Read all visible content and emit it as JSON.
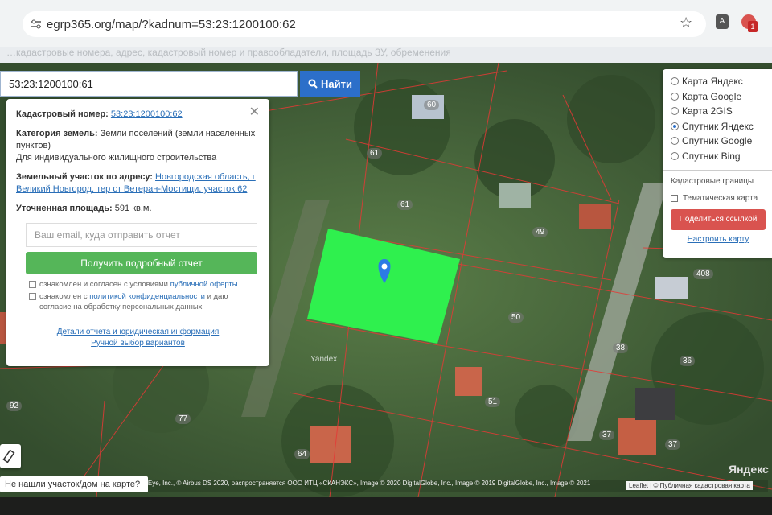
{
  "browser": {
    "url": "egrp365.org/map/?kadnum=53:23:1200100:62"
  },
  "page_strip_text": "…кадастровые номера, адрес, кадастровый номер и правообладатели, площадь ЗУ, обременения",
  "search": {
    "value": "53:23:1200100:61",
    "button_label": "Найти"
  },
  "info_panel": {
    "cadastral_label": "Кадастровый номер:",
    "cadastral_value": "53:23:1200100:62",
    "category_label": "Категория земель:",
    "category_value": "Земли поселений (земли населенных пунктов)",
    "use_value": "Для индивидуального жилищного строительства",
    "address_label": "Земельный участок по адресу:",
    "address_value": "Новгородская область, г Великий Новгород, тер ст Ветеран-Мостищи, участок 62",
    "area_label": "Уточненная площадь:",
    "area_value": "591 кв.м.",
    "email_placeholder": "Ваш email, куда отправить отчет",
    "report_button": "Получить подробный отчет",
    "consent1_text": "ознакомлен и согласен с условиями",
    "consent1_link": "публичной оферты",
    "consent2_text": "ознакомлен с",
    "consent2_link": "политикой конфиденциальности",
    "consent2_rest": "и даю согласие на обработку персональных данных",
    "link_details": "Детали отчета и юридическая информация",
    "link_manual": "Ручной выбор вариантов"
  },
  "layers": {
    "options": [
      {
        "label": "Карта Яндекс",
        "selected": false
      },
      {
        "label": "Карта Google",
        "selected": false
      },
      {
        "label": "Карта 2GIS",
        "selected": false
      },
      {
        "label": "Спутник Яндекс",
        "selected": true
      },
      {
        "label": "Спутник Google",
        "selected": false
      },
      {
        "label": "Спутник Bing",
        "selected": false
      }
    ],
    "cadastral_borders": "Кадастровые границы",
    "thematic_map": "Тематическая карта",
    "share_button": "Поделиться ссылкой",
    "configure_link": "Настроить карту"
  },
  "map": {
    "plot_labels": [
      "60",
      "61",
      "61",
      "49",
      "50",
      "408",
      "38",
      "36",
      "51",
      "37",
      "37",
      "77",
      "64",
      "92"
    ],
    "watermark": "Yandex",
    "logo": "Яндекс",
    "copyright": "eoEye, Inc., © Airbus DS 2020, распространяется ООО ИТЦ «СКАНЭКС», Image © 2020 DigitalGlobe, Inc., Image © 2019 DigitalGlobe, Inc., Image © 2021",
    "leaflet": "Leaflet | © Публичная кадастровая карта",
    "selected_color": "#2ff04e"
  },
  "not_found_button": "Не нашли участок/дом на карте?"
}
